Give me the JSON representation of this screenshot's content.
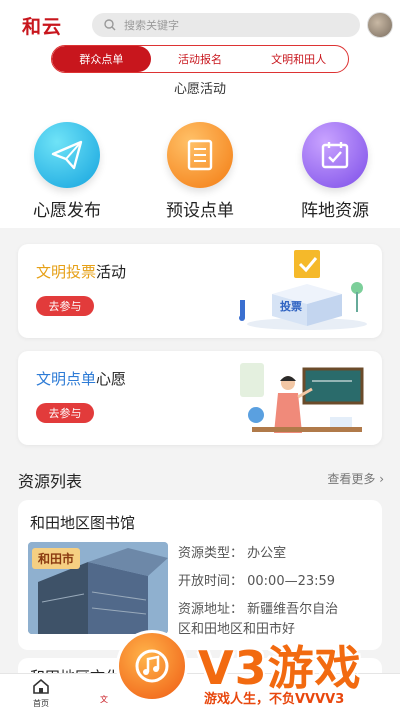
{
  "header": {
    "logo": "和云",
    "search_placeholder": "搜索关键字"
  },
  "tabs": [
    {
      "label": "群众点单",
      "active": true
    },
    {
      "label": "活动报名",
      "active": false
    },
    {
      "label": "文明和田人",
      "active": false
    }
  ],
  "section_title": "心愿活动",
  "features": [
    {
      "label": "心愿发布",
      "icon": "paper-plane-icon"
    },
    {
      "label": "预设点单",
      "icon": "list-document-icon"
    },
    {
      "label": "阵地资源",
      "icon": "calendar-check-icon"
    }
  ],
  "cards": [
    {
      "title_highlight": "文明投票",
      "title_rest": "活动",
      "button": "去参与",
      "illustration_text": "投票"
    },
    {
      "title_highlight": "文明点单",
      "title_rest": "心愿",
      "button": "去参与"
    }
  ],
  "resources": {
    "heading": "资源列表",
    "more": "查看更多 ›",
    "items": [
      {
        "name": "和田地区图书馆",
        "tag": "和田市",
        "type_line": "资源类型：  办公室",
        "time_line": "开放时间：  00:00—23:59",
        "addr_line1": "资源地址：  新疆维吾尔自治",
        "addr_line2": "区和田地区和田市好"
      },
      {
        "name": "和田地区文化"
      }
    ]
  },
  "bottom_nav": {
    "home": "首页",
    "second": "文"
  },
  "watermark": {
    "brand": "V3游戏",
    "slogan": "游戏人生，不负VVVV3"
  },
  "colors": {
    "primary_red": "#c8161d",
    "vote_highlight": "#e6a017",
    "order_highlight": "#2d7bd6",
    "watermark_orange": "#f26a10"
  }
}
